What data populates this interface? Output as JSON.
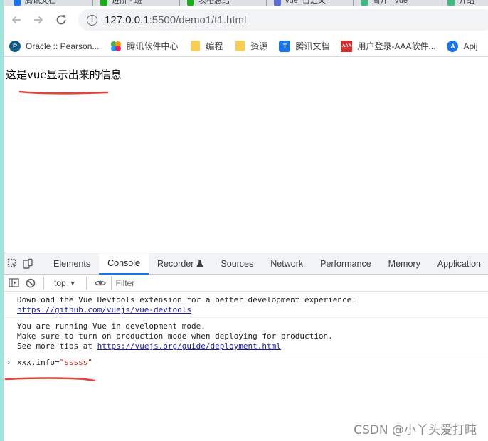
{
  "tabs": [
    {
      "label": "腾讯文档",
      "color": "#1a73e8"
    },
    {
      "label": "进阶 - 班",
      "color": "#1aad19"
    },
    {
      "label": "表格总结",
      "color": "#1aad19"
    },
    {
      "label": "vue_自定义",
      "color": "#5b6bd6"
    },
    {
      "label": "简介 | Vue",
      "color": "#42b883"
    },
    {
      "label": "介绍",
      "color": "#42b883"
    }
  ],
  "address": {
    "host": "127.0.0.1",
    "path": ":5500/demo1/t1.html"
  },
  "bookmarks": [
    {
      "label": "Oracle :: Pearson...",
      "icon": "pearson-icon",
      "color": "#0d5c8a"
    },
    {
      "label": "腾讯软件中心",
      "icon": "tencent-software-icon",
      "color": "#ff9800"
    },
    {
      "label": "编程",
      "icon": "folder-icon",
      "color": "#f7cd5a"
    },
    {
      "label": "资源",
      "icon": "folder-icon",
      "color": "#f7cd5a"
    },
    {
      "label": "腾讯文档",
      "icon": "tencent-docs-icon",
      "color": "#1a73e8"
    },
    {
      "label": "用户登录-AAA软件...",
      "icon": "aaa-icon",
      "color": "#d32f2f"
    },
    {
      "label": "Apij",
      "icon": "api-icon",
      "color": "#1a73e8"
    }
  ],
  "page": {
    "message": "这是vue显示出来的信息"
  },
  "devtools": {
    "tabs": [
      "Elements",
      "Console",
      "Recorder",
      "Sources",
      "Network",
      "Performance",
      "Memory",
      "Application"
    ],
    "active_tab": "Console",
    "context": "top",
    "filter_placeholder": "Filter",
    "messages": {
      "m1_text": "Download the Vue Devtools extension for a better development experience:",
      "m1_link": "https://github.com/vuejs/vue-devtools",
      "m2_line1": "You are running Vue in development mode.",
      "m2_line2": "Make sure to turn on production mode when deploying for production.",
      "m2_line3_prefix": "See more tips at ",
      "m2_link": "https://vuejs.org/guide/deployment.html"
    },
    "input": {
      "code": "xxx.info=",
      "string": "\"sssss\""
    }
  },
  "watermark": "CSDN @小丫头爱打盹",
  "colors": {
    "accent": "#1a73e8",
    "annotation_red": "#e0443a",
    "link": "#1a1aa6"
  }
}
